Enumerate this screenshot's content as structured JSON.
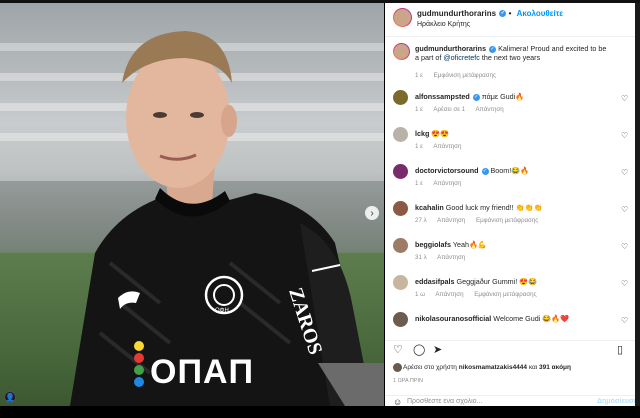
{
  "post": {
    "author": "gudmundurthorarins",
    "follow_label": "Ακολουθείτε",
    "location": "Ηράκλειο Κρήτης",
    "caption_text": "Kalimera! Proud and excited to be a part of",
    "caption_mention": "@oficretefc",
    "caption_rest": "the next two years",
    "caption_time": "1 ε",
    "caption_translate": "Εμφάνιση μετάφρασης"
  },
  "comments": [
    {
      "user": "alfonssampsted",
      "text": "πάμε Gudi🔥",
      "time": "1 ε",
      "likes": "Αρέσει σε 1",
      "reply": "Απάντηση",
      "translate": ""
    },
    {
      "user": "lckg",
      "text": "😍😍",
      "time": "1 ε",
      "likes": "",
      "reply": "Απάντηση",
      "translate": ""
    },
    {
      "user": "doctorvictorsound",
      "text": "Boom!😂🔥",
      "time": "1 ε",
      "likes": "",
      "reply": "Απάντηση",
      "translate": ""
    },
    {
      "user": "kcahalin",
      "text": "Good luck my friend!! 👏👏👏",
      "time": "27 λ",
      "likes": "",
      "reply": "Απάντηση",
      "translate": "Εμφάνιση μετάφρασης"
    },
    {
      "user": "beggiolafs",
      "text": "Yeah🔥💪",
      "time": "31 λ",
      "likes": "",
      "reply": "Απάντηση",
      "translate": ""
    },
    {
      "user": "eddasifpals",
      "text": "Geggjaður Gummi! 😍😂",
      "time": "1 ω",
      "likes": "",
      "reply": "Απάντηση",
      "translate": "Εμφάνιση μετάφρασης"
    },
    {
      "user": "nikolasouranosofficial",
      "text": "Welcome Gudi 😂🔥❤️",
      "time": "",
      "likes": "",
      "reply": "",
      "translate": ""
    }
  ],
  "likes_line": {
    "prefix": "Αρέσει στο χρήστη",
    "user": "nikosmamatzakis4444",
    "conj": "και",
    "count": "391 ακόμη"
  },
  "date": "1 ΩΡΑ ΠΡΙΝ",
  "comment_input": {
    "placeholder": "Προσθέστε ένα σχόλιο...",
    "post_label": "Δημοσίευση"
  },
  "jersey": {
    "sponsor": "ΟΠΑΠ",
    "side_text": "ZAROS",
    "crest_text": "ΟΦΗ"
  },
  "colors": {
    "accent_blue": "#0095f6",
    "verified_blue": "#3897f0",
    "text": "#262626",
    "muted": "#8e8e8e"
  },
  "icons": [
    "heart-icon",
    "comment-icon",
    "share-icon",
    "save-icon",
    "emoji-icon",
    "verified-icon",
    "tag-icon",
    "chevron-right-icon"
  ]
}
